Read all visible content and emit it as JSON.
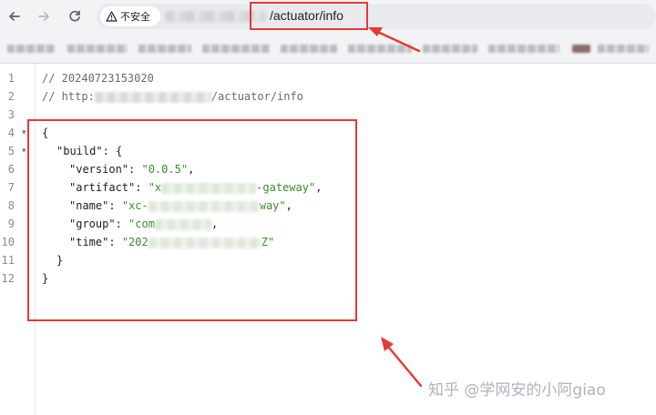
{
  "browser": {
    "security_label": "不安全",
    "url_tail": "/actuator/info"
  },
  "code": {
    "lines": [
      {
        "num": "1",
        "comment_date": "// 20240723153020"
      },
      {
        "num": "2",
        "comment_prefix": "// http:",
        "comment_suffix": "/actuator/info"
      },
      {
        "num": "3"
      },
      {
        "num": "4",
        "text": "{"
      },
      {
        "num": "5",
        "key": "\"build\"",
        "text": ": {"
      },
      {
        "num": "6",
        "key": "\"version\"",
        "value": "\"0.0.5\""
      },
      {
        "num": "7",
        "key": "\"artifact\"",
        "value_prefix": "\"x",
        "value_suffix": "-gateway\""
      },
      {
        "num": "8",
        "key": "\"name\"",
        "value_prefix": "\"xc-",
        "value_suffix": "way\""
      },
      {
        "num": "9",
        "key": "\"group\"",
        "value_prefix": "\"com"
      },
      {
        "num": "10",
        "key": "\"time\"",
        "value_prefix": "\"202",
        "value_suffix": "Z\""
      },
      {
        "num": "11",
        "text": "}"
      },
      {
        "num": "12",
        "text": "}"
      }
    ]
  },
  "watermark": "知乎 @学网安的小阿giao",
  "colors": {
    "highlight": "#e53935",
    "string": "#3c8a2e"
  },
  "icons": [
    "back-arrow-icon",
    "forward-arrow-icon",
    "reload-icon",
    "warning-icon",
    "fold-arrow-icon"
  ]
}
